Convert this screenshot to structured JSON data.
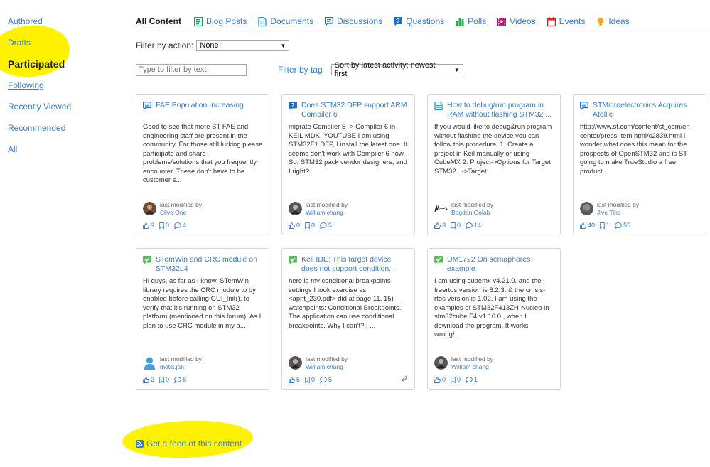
{
  "sidebar": {
    "items": [
      {
        "label": "Authored"
      },
      {
        "label": "Drafts"
      },
      {
        "label": "Participated"
      },
      {
        "label": "Following"
      },
      {
        "label": "Recently Viewed"
      },
      {
        "label": "Recommended"
      },
      {
        "label": "All"
      }
    ]
  },
  "typebar": {
    "items": [
      {
        "label": "All Content"
      },
      {
        "label": "Blog Posts",
        "icon": "blog-post-icon"
      },
      {
        "label": "Documents",
        "icon": "document-icon"
      },
      {
        "label": "Discussions",
        "icon": "discussion-icon"
      },
      {
        "label": "Questions",
        "icon": "question-icon"
      },
      {
        "label": "Polls",
        "icon": "poll-icon"
      },
      {
        "label": "Videos",
        "icon": "video-icon"
      },
      {
        "label": "Events",
        "icon": "event-icon"
      },
      {
        "label": "Ideas",
        "icon": "idea-icon"
      }
    ]
  },
  "filters": {
    "action_label": "Filter by action:",
    "action_value": "None",
    "text_placeholder": "Type to filter by text",
    "tag_label": "Filter by tag",
    "sort_value": "Sort by latest activity: newest first"
  },
  "cards": [
    {
      "type": "discussion",
      "title": "FAE Population Increasing",
      "body": "Good to see that more ST FAE and engineering staff are present in the community. For those still lurking please participate and share problems/solutions that you frequently encounter. These don't have to be customer s...",
      "meta_label": "last modified by",
      "user": "Clive One",
      "likes": "9",
      "bookmarks": "0",
      "comments": "4"
    },
    {
      "type": "question",
      "title": "Does STM32 DFP support ARM Compiler 6",
      "body": "migrate Compiler 5 -> Compiler 6 in KEIL MDK. YOUTUBE I am using STM32F1 DFP, I install the latest one. It seems don't work with Compiler 6 now.  So, STM32 pack vendor designers, and I right?",
      "meta_label": "last modified by",
      "user": "William chang",
      "likes": "0",
      "bookmarks": "0",
      "comments": "5"
    },
    {
      "type": "document",
      "title": "How to debug/run program in RAM without flashing STM32 ...",
      "body": "If you would like to debug&run program without flashing the device you can follow this procedure: 1. Create a project in Keil manually or using CubeMX   2. Project->Options for Target STM32...->Target...",
      "meta_label": "last modified by",
      "user": "Bogdan Golab",
      "likes": "3",
      "bookmarks": "0",
      "comments": "14"
    },
    {
      "type": "discussion",
      "title": "STMicroelectronics Acquires Atollic",
      "body": "http://www.st.com/content/st_com/en center/press-item.html/c2839.html   I wonder what does this mean for the prospects of OpenSTM32 and is ST going to make TrueStudio a free product.",
      "meta_label": "last modified by",
      "user": "Jive Tihs",
      "likes": "40",
      "bookmarks": "1",
      "comments": "55"
    },
    {
      "type": "answered",
      "title": "STemWin and CRC module on STM32L4",
      "body": "Hi guys, as far as I know, STemWin library requires the CRC module to by enabled before calling GUI_Init(), to verify that it's running on STM32 platform (mentioned on this forum). As I plan to use CRC module in my a...",
      "meta_label": "last modified by",
      "user": "matik.jan",
      "likes": "2",
      "bookmarks": "0",
      "comments": "8"
    },
    {
      "type": "answered",
      "title": "Keil IDE: This target device does not support condition...",
      "body": "here is my conditional breakpoints settings   I took exercise as <apnt_230.pdf> did at page 11, 15) watchpoints: Conditional Breakpoints. The application can use conditional breakpoints. Why I can't? I ...",
      "meta_label": "last modified by",
      "user": "William chang",
      "likes": "5",
      "bookmarks": "0",
      "comments": "5"
    },
    {
      "type": "answered",
      "title": "UM1722 On semaphores example",
      "body": "I am using cubemx v4.21.0. and the freertos version is 8.2.3. & the cmsis-rtos version is 1.02. I am using the examples of STM32F413ZH-Nucleo in stm32cube F4 v1.16.0 , when I download the program. It works wrong!...",
      "meta_label": "last modified by",
      "user": "William chang",
      "likes": "0",
      "bookmarks": "0",
      "comments": "1"
    }
  ],
  "feed": {
    "label": "Get a feed of this content"
  },
  "colors": {
    "link": "#3a7bc8",
    "highlight": "#fff200",
    "answered": "#5cb85c"
  }
}
